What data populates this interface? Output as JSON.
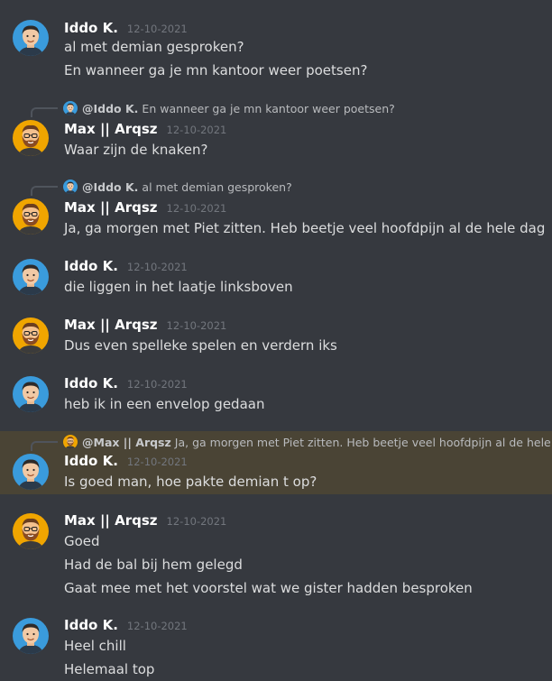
{
  "users": {
    "iddo": {
      "name": "Iddo K.",
      "avatar_icon": "man-avatar-icon",
      "avatar_bg": "#3a9bdc"
    },
    "max": {
      "name": "Max || Arqsz",
      "avatar_icon": "bearded-man-avatar-icon",
      "avatar_bg": "#f0a500"
    }
  },
  "messages": [
    {
      "author": "Iddo K.",
      "timestamp": "12-10-2021",
      "lines": [
        "al met demian gesproken?",
        "En wanneer ga je mn kantoor weer poetsen?"
      ]
    },
    {
      "reply_to": {
        "author": "@Iddo K.",
        "text": "En wanneer ga je mn kantoor weer poetsen?"
      },
      "author": "Max || Arqsz",
      "timestamp": "12-10-2021",
      "lines": [
        "Waar zijn de knaken?"
      ]
    },
    {
      "reply_to": {
        "author": "@Iddo K.",
        "text": "al met demian gesproken?"
      },
      "author": "Max || Arqsz",
      "timestamp": "12-10-2021",
      "lines": [
        "Ja, ga morgen met Piet zitten. Heb beetje veel hoofdpijn al de hele dag"
      ]
    },
    {
      "author": "Iddo K.",
      "timestamp": "12-10-2021",
      "lines": [
        "die liggen in het laatje linksboven"
      ]
    },
    {
      "author": "Max || Arqsz",
      "timestamp": "12-10-2021",
      "lines": [
        "Dus even spelleke spelen en verdern iks"
      ]
    },
    {
      "author": "Iddo K.",
      "timestamp": "12-10-2021",
      "lines": [
        "heb ik in een envelop gedaan"
      ]
    },
    {
      "reply_to": {
        "author": "@Max || Arqsz",
        "text": "Ja, ga morgen met Piet zitten. Heb beetje veel hoofdpijn al de hele dag"
      },
      "author": "Iddo K.",
      "timestamp": "12-10-2021",
      "highlighted": true,
      "lines": [
        "Is goed man, hoe pakte demian t op?"
      ]
    },
    {
      "author": "Max || Arqsz",
      "timestamp": "12-10-2021",
      "lines": [
        "Goed",
        "Had de bal bij hem gelegd",
        "Gaat mee met het voorstel wat we gister hadden besproken"
      ]
    },
    {
      "author": "Iddo K.",
      "timestamp": "12-10-2021",
      "lines": [
        "Heel chill",
        "Helemaal top"
      ]
    }
  ],
  "colors": {
    "background": "#36393f",
    "highlight": "#4a4435",
    "author": "#ffffff",
    "timestamp": "#72767d",
    "text": "#dcddde"
  }
}
